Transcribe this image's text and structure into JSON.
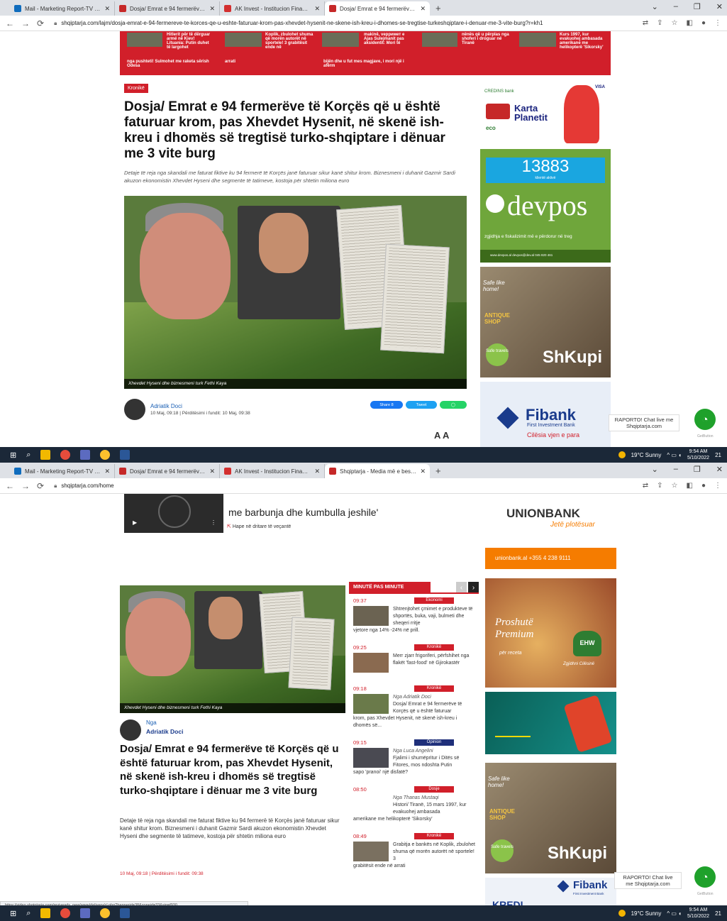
{
  "window1": {
    "tabs": [
      {
        "label": "Mail - Marketing Report-TV - Ou",
        "color": "#0f6cbd"
      },
      {
        "label": "Dosja/ Emrat e 94 fermerëve të K",
        "color": "#c62828"
      },
      {
        "label": "AK Invest - Institucion Financiar",
        "color": "#d32f2f"
      },
      {
        "label": "Dosja/ Emrat e 94 fermerëve të K",
        "color": "#c62828"
      }
    ],
    "url": "shqiptarja.com/lajm/dosja-emrat-e-94-fermereve-te-korces-qe-u-eshte-faturuar-krom-pas-xhevdet-hysenit-ne-skene-ish-kreu-i-dhomes-se-tregtise-turkeshqiptare-i-denuar-me-3-vite-burg?r=kh1",
    "top_strip": {
      "items": [
        "Hitlerit për të dërguar armë në Kiev! Lituania: Putin duhet të largohet",
        "ngа pushteti! Sulmohet me raketa sërish Odesa",
        "arrati",
        "Koplik, zbulohet shuma që morën autorët në sportele! 3 grabitësit ende në",
        "bijën dhe u fut mes magjave, i mori një i afërm",
        "makinë, vepримет e Ajas Sulejmanit pas aksidentit: Mori të",
        "nënës që u përplas nga shoferi i droguar në Tiranë",
        "Kurs 1997, kur evakuohej ambasada amerikane me helikopterë 'Sikorsky'"
      ]
    },
    "category": "Kronikë",
    "headline": "Dosja/ Emrat e 94 fermerëve të Korçës që u është faturuar krom, pas Xhevdet Hysenit, në skenë ish-kreu i dhomës së tregtisë turko-shqiptare i dënuar me 3 vite burg",
    "lead": "Detaje të reja nga skandali me faturat fiktive ku 94 fermerë të Korçës janë faturuar sikur kanë shitur krom. Biznesmeni i duhanit Gazmir Sardi akuzon ekonomistin Xhevdet Hyseni dhe segmente të tatimeve, kostoja për shtetin miliona euro",
    "photo_caption": "Xhevdet Hyseni dhe biznesmeni turk Fethi Kaya",
    "author": "Adriatik Doci",
    "meta": "10 Maj, 09:18 | Përditësimi i fundit: 10 Maj, 09:38",
    "share": {
      "facebook": "Share 8",
      "twitter": "Tweet"
    },
    "font_controls": "A  A",
    "ads": {
      "credins": {
        "brand": "CREDINS bank",
        "card": "Karta Planetit",
        "visa": "VISA",
        "eco": "eco"
      },
      "devpos": {
        "count": "13883",
        "count_label": "klientë aktivë",
        "brand": "devpos",
        "tagline": "zgjidhja e fiskalizimit më e përdorur në treg",
        "footer": "www.devpos.al   devpos@dev.al   045 820 461"
      },
      "skupi": {
        "safe": "Safe like home!",
        "antique": "ANTIQUE SHOP",
        "safe_travels": "Safe travels",
        "brand": "ShKupi"
      },
      "fibank": {
        "brand": "Fibank",
        "sub": "First Investment Bank",
        "slogan": "Cilësia vjen e para"
      }
    },
    "chat": {
      "label": "RAPORTO! Chat live me Shqiptarja.com",
      "getbutton": "GetButton"
    },
    "taskbar": {
      "weather": "19°C  Sunny",
      "time": "9:54 AM",
      "date": "5/10/2022",
      "notif": "21"
    }
  },
  "window2": {
    "tabs": [
      {
        "label": "Mail - Marketing Report-TV - Ou",
        "color": "#0f6cbd"
      },
      {
        "label": "Dosja/ Emrat e 94 fermerëve të K",
        "color": "#c62828"
      },
      {
        "label": "AK Invest - Institucion Financiar",
        "color": "#d32f2f"
      },
      {
        "label": "Shqiptarja - Media më e besuesh",
        "color": "#c62828"
      }
    ],
    "url": "shqiptarja.com/home",
    "video_title": "me barbunja dhe kumbulla jeshile'",
    "video_sub": "Hape në dritare të veçantë",
    "photo_caption": "Xhevdet Hyseni dhe biznesmeni turk Fethi Kaya",
    "by": "Nga",
    "author": "Adriatik Doci",
    "headline": "Dosja/ Emrat e 94 fermerëve të Korçës që u është faturuar krom, pas Xhevdet Hysenit, në skenë ish-kreu i dhomës së tregtisë turko-shqiptare i dënuar me 3 vite burg",
    "lead": "Detaje të reja nga skandali me faturat fiktive ku 94 fermerë të Korçës janë faturuar sikur kanë shitur krom. Biznesmeni i duhanit Gazmir Sardi akuzon ekonomistin Xhevdet Hyseni dhe segmente të tatimeve, kostoja për shtetin miliona euro",
    "date": "10 Maj, 09:18 | Përditësimi i fundit: 09:38",
    "minute_header": "MINUTË PAS MINUTE",
    "minute_items": [
      {
        "time": "09:37",
        "cat": "Ekonomi",
        "cat_color": "#d11f2a",
        "by": "",
        "text": "Shtrenjtohet çmimet e produkteve të shportës, buka, vaji, bulmeti dhe sheqeri rritje",
        "rest": "vjetore nga 14% -24% në prill."
      },
      {
        "time": "09:25",
        "cat": "Kronikë",
        "cat_color": "#d11f2a",
        "by": "",
        "text": "Merr zjarr frigoriferi, përfshihet nga flakët 'fast-food' në Gjirokastër",
        "rest": ""
      },
      {
        "time": "09:18",
        "cat": "Kronikë",
        "cat_color": "#d11f2a",
        "by": "Nga Adriatik Doci",
        "text": "Dosja/ Emrat e 94 fermerëve të Korçës që u është faturuar",
        "rest": "krom, pas Xhevdet Hysenit, në skenë ish-kreu i dhomës së..."
      },
      {
        "time": "09:15",
        "cat": "Opinion",
        "cat_color": "#1f2f7a",
        "by": "Nga Luca Angelini",
        "text": "Fjalimi i shumëpritur i Ditës së Fitores, mos ndoshta Putin",
        "rest": "sapo 'pranoi' një disfatë?"
      },
      {
        "time": "08:50",
        "cat": "Dosje",
        "cat_color": "#d11f2a",
        "by": "Nga Thanas Mustaqi",
        "text": "Histori/ Tiranë, 15 mars 1997, kur evakuohej ambasada",
        "rest": "amerikane me helikopterë 'Sikorsky'"
      },
      {
        "time": "08:49",
        "cat": "Kronikë",
        "cat_color": "#d11f2a",
        "by": "",
        "text": "Grabitja e bankës në Koplik, zbulohet shuma që morën autorët në sportele! 3",
        "rest": "grabitësit ende në arrati"
      }
    ],
    "ads": {
      "unionbank": {
        "brand": "UNIONBANK",
        "script": "Jetë plotësuar",
        "site": "unionbank.al",
        "phone": "+355 4 238 9111"
      },
      "proshutte": {
        "title": "Proshutë Premium",
        "sub": "për receta",
        "badge": "EHW",
        "quality": "Zgjidhni Cilësinë"
      },
      "skupi": {
        "safe": "Safe like home!",
        "antique": "ANTIQUE SHOP",
        "safe_travels": "Safe travels",
        "brand": "ShKupi"
      },
      "fibank": {
        "brand": "Fibank",
        "sub": "First Investment Bank",
        "kredi": "KREDI"
      }
    },
    "status_url": "https://video.shqiptarja.com/reviveads_new/www/delivery/cl.php?bannerid=38&zoneid=33&sig=f930...",
    "chat": {
      "label": "RAPORTO! Chat live me Shqiptarja.com",
      "getbutton": "GetButton"
    },
    "taskbar": {
      "weather": "19°C  Sunny",
      "time": "9:54 AM",
      "date": "5/10/2022",
      "notif": "21"
    }
  }
}
